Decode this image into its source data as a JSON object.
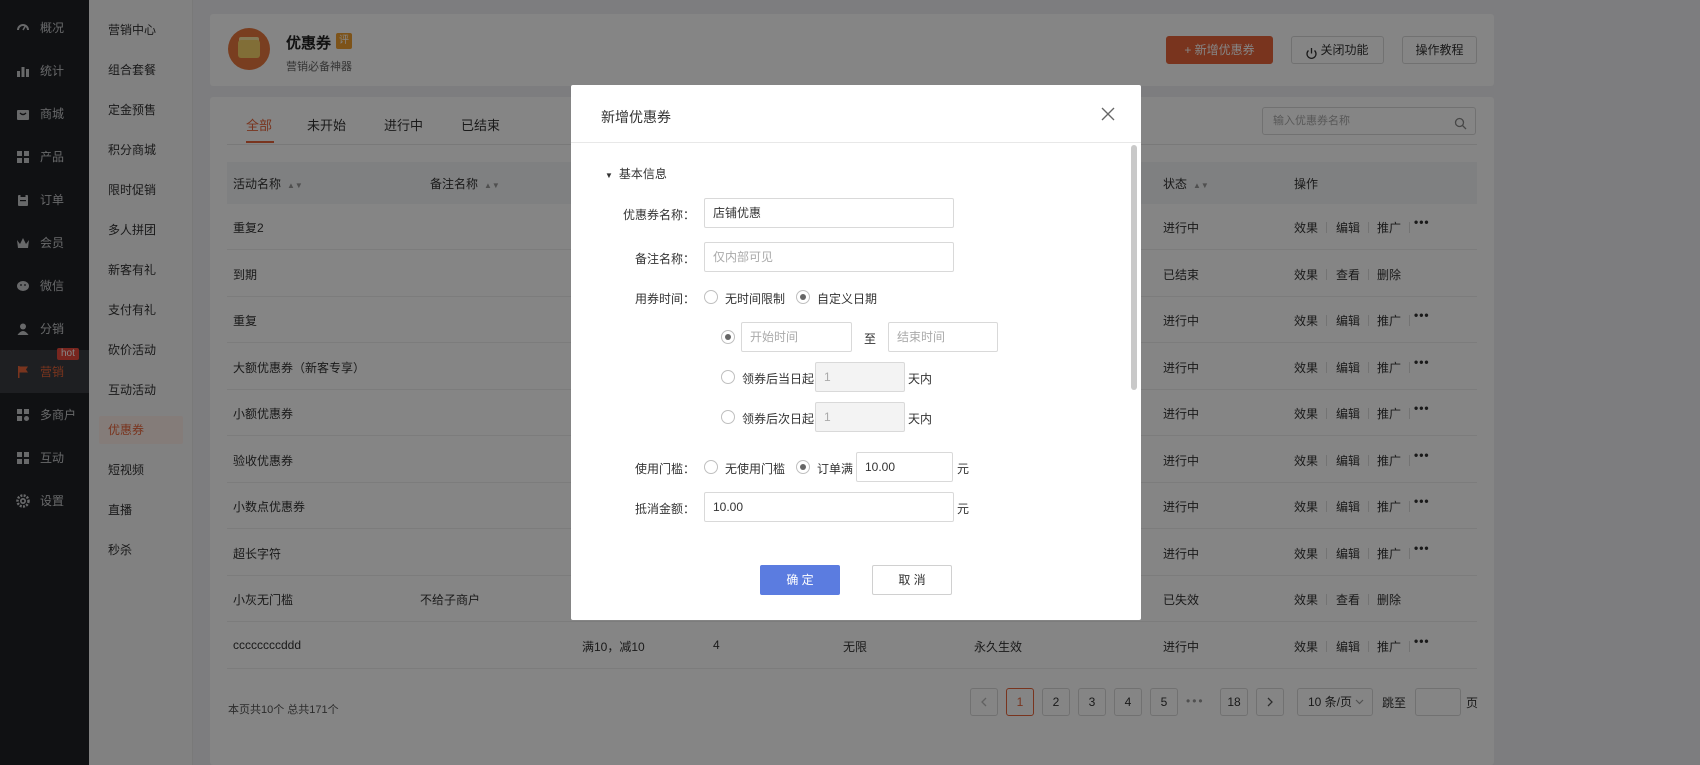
{
  "nav": {
    "items": [
      {
        "label": "概况",
        "icon": "dashboard-icon"
      },
      {
        "label": "统计",
        "icon": "chart-icon"
      },
      {
        "label": "商城",
        "icon": "shop-icon"
      },
      {
        "label": "产品",
        "icon": "grid-icon"
      },
      {
        "label": "订单",
        "icon": "clipboard-icon"
      },
      {
        "label": "会员",
        "icon": "crown-icon"
      },
      {
        "label": "微信",
        "icon": "wechat-icon"
      },
      {
        "label": "分销",
        "icon": "user-icon"
      },
      {
        "label": "营销",
        "icon": "flag-icon"
      },
      {
        "label": "多商户",
        "icon": "store-icon"
      },
      {
        "label": "互动",
        "icon": "apps-icon"
      },
      {
        "label": "设置",
        "icon": "gear-icon"
      }
    ],
    "hot_badge": "hot"
  },
  "submenu": {
    "items": [
      "营销中心",
      "组合套餐",
      "定金预售",
      "积分商城",
      "限时促销",
      "多人拼团",
      "新客有礼",
      "支付有礼",
      "砍价活动",
      "互动活动",
      "优惠券",
      "短视频",
      "直播",
      "秒杀"
    ]
  },
  "header": {
    "title": "优惠券",
    "badge": "评",
    "subtitle": "营销必备神器",
    "add_button": "+ 新增优惠券",
    "close_button": "关闭功能",
    "tutorial_button": "操作教程"
  },
  "tabs": [
    "全部",
    "未开始",
    "进行中",
    "已结束"
  ],
  "search": {
    "placeholder": "输入优惠券名称"
  },
  "table": {
    "headers": {
      "name": "活动名称",
      "remark": "备注名称",
      "status": "状态",
      "action": "操作"
    },
    "rows": [
      {
        "name": "重复2",
        "remark": "",
        "rule": "",
        "qty": "",
        "limit": "",
        "valid": "",
        "status": "进行中",
        "ops": [
          "效果",
          "编辑",
          "推广"
        ],
        "more": true
      },
      {
        "name": "到期",
        "remark": "",
        "rule": "",
        "qty": "",
        "limit": "",
        "valid": "",
        "status": "已结束",
        "ops": [
          "效果",
          "查看",
          "删除"
        ],
        "more": false
      },
      {
        "name": "重复",
        "remark": "",
        "rule": "",
        "qty": "",
        "limit": "",
        "valid": "",
        "status": "进行中",
        "ops": [
          "效果",
          "编辑",
          "推广"
        ],
        "more": true
      },
      {
        "name": "大额优惠券（新客专享）",
        "remark": "",
        "rule": "",
        "qty": "",
        "limit": "",
        "valid": "",
        "status": "进行中",
        "ops": [
          "效果",
          "编辑",
          "推广"
        ],
        "more": true
      },
      {
        "name": "小额优惠券",
        "remark": "",
        "rule": "",
        "qty": "",
        "limit": "",
        "valid": "",
        "status": "进行中",
        "ops": [
          "效果",
          "编辑",
          "推广"
        ],
        "more": true
      },
      {
        "name": "验收优惠券",
        "remark": "",
        "rule": "",
        "qty": "",
        "limit": "",
        "valid": "",
        "status": "进行中",
        "ops": [
          "效果",
          "编辑",
          "推广"
        ],
        "more": true
      },
      {
        "name": "小数点优惠券",
        "remark": "",
        "rule": "",
        "qty": "",
        "limit": "",
        "valid": "",
        "status": "进行中",
        "ops": [
          "效果",
          "编辑",
          "推广"
        ],
        "more": true
      },
      {
        "name": "超长字符",
        "remark": "",
        "rule": "",
        "qty": "",
        "limit": "",
        "valid": "",
        "status": "进行中",
        "ops": [
          "效果",
          "编辑",
          "推广"
        ],
        "more": true
      },
      {
        "name": "小灰无门槛",
        "remark": "不给子商户",
        "rule": "",
        "qty": "",
        "limit": "",
        "valid": "",
        "status": "已失效",
        "ops": [
          "效果",
          "查看",
          "删除"
        ],
        "more": false
      },
      {
        "name": "ccccccccddd",
        "remark": "",
        "rule": "满10，减10",
        "qty": "4",
        "limit": "无限",
        "valid": "永久生效",
        "status": "进行中",
        "ops": [
          "效果",
          "编辑",
          "推广"
        ],
        "more": true
      }
    ]
  },
  "footer": {
    "summary": "本页共10个 总共171个",
    "pages": [
      "1",
      "2",
      "3",
      "4",
      "5",
      "18"
    ],
    "dots": "•••",
    "page_size": "10 条/页",
    "jump_label": "跳至",
    "page_label": "页"
  },
  "modal": {
    "title": "新增优惠券",
    "section": "基本信息",
    "name_label": "优惠券名称：",
    "name_value": "店铺优惠",
    "remark_label": "备注名称：",
    "remark_placeholder": "仅内部可见",
    "time_label": "用券时间：",
    "time_opt_none": "无时间限制",
    "time_opt_custom": "自定义日期",
    "start_placeholder": "开始时间",
    "to_text": "至",
    "end_placeholder": "结束时间",
    "same_day_label": "领券后当日起",
    "next_day_label": "领券后次日起",
    "days_value_1": "1",
    "days_value_2": "1",
    "days_unit": "天内",
    "threshold_label": "使用门槛：",
    "threshold_none": "无使用门槛",
    "threshold_full": "订单满",
    "threshold_value": "10.00",
    "yuan": "元",
    "discount_label": "抵消金额：",
    "discount_value": "10.00",
    "ok": "确 定",
    "cancel": "取 消"
  },
  "colors": {
    "accent": "#e8653a",
    "modal_primary": "#5b7ce0",
    "nav_bg": "#202226"
  }
}
